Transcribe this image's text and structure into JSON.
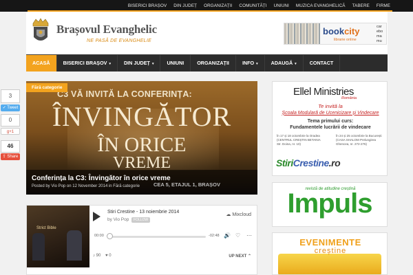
{
  "topbar": {
    "items": [
      "BISERICI BRAȘOV",
      "DIN JUDEȚ",
      "ORGANIZAȚII",
      "COMUNITĂȚI",
      "UNIUNI",
      "MUZICA EVANGHELICĂ",
      "TABERE",
      "FIRME"
    ]
  },
  "site": {
    "title": "Brașovul Evanghelic",
    "tagline": "NE PASĂ DE EVANGHELIE"
  },
  "header_ad": {
    "brand_a": "book",
    "brand_b": "city",
    "subtitle": "librarie online",
    "side_text": "car ebo ma mu"
  },
  "nav": {
    "items": [
      {
        "label": "ACASĂ",
        "active": true,
        "dropdown": false
      },
      {
        "label": "BISERICI BRAȘOV",
        "active": false,
        "dropdown": true
      },
      {
        "label": "DIN JUDEȚ",
        "active": false,
        "dropdown": true
      },
      {
        "label": "UNIUNI",
        "active": false,
        "dropdown": false
      },
      {
        "label": "ORGANIZAȚII",
        "active": false,
        "dropdown": false
      },
      {
        "label": "INFO",
        "active": false,
        "dropdown": true
      },
      {
        "label": "ADAUGĂ",
        "active": false,
        "dropdown": true
      },
      {
        "label": "CONTACT",
        "active": false,
        "dropdown": false
      }
    ],
    "chevron": "▾"
  },
  "share": {
    "linkedin_count": "3",
    "twitter_label": "Tweet",
    "gplus_count": "0",
    "gplus_label": "g+1",
    "share_count": "46",
    "share_label": "Share"
  },
  "featured": {
    "category": "Fără categorie",
    "image_line1": "C3 VĂ INVITĂ LA CONFERINȚA:",
    "image_line2": "ÎNVINGĂTOR",
    "image_line3": "ÎN ORICE",
    "image_line4": "VREME",
    "title": "Conferința la C3: Învingător în orice vreme",
    "meta": "Posted by Vio Pop on 12 November 2014 in Fără categorie",
    "address_fragment": "CEA 5, ETAJUL 1, BRAȘOV"
  },
  "mixcloud": {
    "thumb_text": "Strict Bible",
    "title": "Stiri Crestine - 13 noiembrie 2014",
    "by": "by Vio Pop",
    "follow": "FOLLOW",
    "brand": "Mixcloud",
    "time_elapsed": "00:00",
    "time_remaining": "-02:48",
    "plays": "90",
    "likes": "0",
    "up_next": "UP NEXT",
    "progress": 0
  },
  "sidebar_ad1": {
    "org": "Ellel Ministries",
    "country": "România",
    "line1": "Te invită la",
    "line2": "Școala Modulară de Ucenicizare și Vindecare",
    "line3": "Tema primului curs:",
    "line4": "Fundamentele lucrării de vindecare",
    "left_small": "În 17 și 18 octombrie la Oradea (CENTRUL CREȘTIN BETANIA Str. Doina, nr. 10)",
    "right_small": "În 24 și 25 octombrie la București (CASA SHALOM Prelungirea Ghencea, nr. 272-276)",
    "brand_a": "Stiri",
    "brand_b": "Crestine",
    "brand_c": ".ro"
  },
  "sidebar_ad2": {
    "subtitle": "revistă de atitudine creștină",
    "title": "Impuls"
  },
  "sidebar_ad3": {
    "line1": "EVENIMENTE",
    "line2": "creștine"
  },
  "icons": {
    "play": "play-icon",
    "cloud": "mixcloud-icon",
    "heart": "heart-icon"
  },
  "colors": {
    "accent": "#f3a31e",
    "nav_bg": "#2c2c2c",
    "topbar_bg": "#161616"
  }
}
